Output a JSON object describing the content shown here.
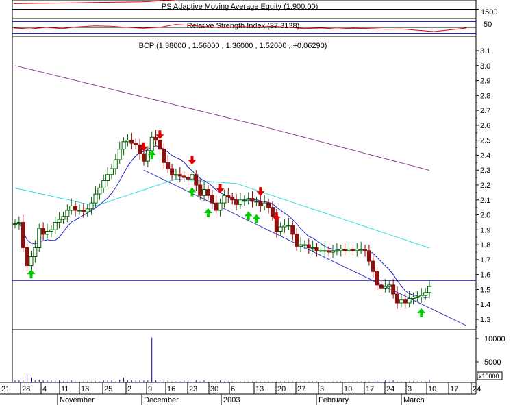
{
  "chart_data": [
    {
      "type": "line",
      "title": "PS Adaptive Moving Average Equity (1,900.00)",
      "y_tick_labels": [
        "1500"
      ],
      "ylim": [
        1400,
        1600
      ],
      "series": [
        {
          "x": [
            0,
            8,
            16,
            24,
            32,
            40,
            48,
            56,
            64,
            72,
            80,
            88,
            96,
            104,
            112
          ],
          "values": [
            1560,
            1565,
            1570,
            1575,
            1580,
            1600,
            1620,
            1640,
            1650,
            1640,
            1660,
            1680,
            1700,
            1700,
            1690
          ]
        }
      ]
    },
    {
      "type": "line",
      "title": "Relative Strength Index (37.3138)",
      "y_tick_labels": [
        "50"
      ],
      "ylim": [
        20,
        80
      ],
      "series": [
        {
          "x": [
            0,
            4,
            8,
            12,
            16,
            20,
            24,
            28,
            32,
            36,
            40,
            44,
            48,
            52,
            56,
            60,
            64,
            68,
            72,
            76,
            80,
            84,
            88,
            92,
            96,
            100,
            104,
            108,
            112
          ],
          "values": [
            48,
            45,
            50,
            46,
            52,
            55,
            54,
            50,
            47,
            50,
            60,
            57,
            52,
            49,
            53,
            51,
            54,
            50,
            46,
            48,
            45,
            47,
            46,
            44,
            45,
            40,
            36,
            42,
            48
          ]
        }
      ]
    },
    {
      "type": "candlestick",
      "title": "BCP (1.38000 , 1.56000 , 1.36000 , 1.52000 , +0.06290)",
      "y_tick_labels": [
        "3.1",
        "3.0",
        "2.9",
        "2.8",
        "2.7",
        "2.6",
        "2.5",
        "2.4",
        "2.3",
        "2.2",
        "2.1",
        "2.0",
        "1.9",
        "1.8",
        "1.7",
        "1.6",
        "1.5",
        "1.4",
        "1.3"
      ],
      "ylim": [
        1.2,
        3.15
      ],
      "x_tick_labels": [
        "21",
        "28",
        "4",
        "11",
        "18",
        "25",
        "2",
        "9",
        "16",
        "23",
        "30",
        "6",
        "13",
        "20",
        "27",
        "3",
        "10",
        "17",
        "24",
        "3",
        "10",
        "17",
        "24"
      ],
      "month_labels": [
        "November",
        "December",
        "2003",
        "February",
        "March"
      ],
      "candles_close": [
        1.94,
        1.95,
        1.78,
        1.66,
        1.72,
        1.78,
        1.91,
        1.87,
        1.89,
        1.9,
        1.95,
        1.97,
        1.99,
        2.03,
        2.06,
        2.03,
        2.03,
        2.02,
        2.04,
        2.08,
        2.14,
        2.18,
        2.23,
        2.27,
        2.31,
        2.37,
        2.44,
        2.49,
        2.5,
        2.48,
        2.47,
        2.41,
        2.36,
        2.43,
        2.52,
        2.5,
        2.44,
        2.35,
        2.31,
        2.27,
        2.27,
        2.26,
        2.25,
        2.24,
        2.27,
        2.2,
        2.13,
        2.17,
        2.13,
        2.08,
        2.03,
        2.08,
        2.13,
        2.12,
        2.1,
        2.07,
        2.1,
        2.1,
        2.11,
        2.09,
        2.09,
        2.06,
        2.08,
        2.05,
        1.99,
        1.89,
        1.92,
        1.93,
        1.93,
        1.87,
        1.79,
        1.8,
        1.8,
        1.78,
        1.78,
        1.76,
        1.76,
        1.76,
        1.75,
        1.76,
        1.76,
        1.77,
        1.76,
        1.77,
        1.76,
        1.77,
        1.77,
        1.76,
        1.69,
        1.62,
        1.53,
        1.51,
        1.52,
        1.53,
        1.47,
        1.41,
        1.43,
        1.41,
        1.44,
        1.45,
        1.45,
        1.46,
        1.48,
        1.52
      ],
      "trend_channel_resistance": 1.56,
      "volume_y_tick_labels": [
        "10000",
        "5000"
      ],
      "volume_unit_label": "x10000",
      "volume": [
        0.2,
        0.2,
        0.2,
        0.9,
        0.5,
        0.2,
        0.3,
        0.2,
        0.2,
        0.2,
        0.2,
        0.2,
        0.1,
        0.1,
        0.2,
        0.1,
        0.1,
        0.1,
        0.1,
        0.1,
        0.1,
        0.1,
        0.2,
        0.2,
        0.2,
        0.1,
        0.3,
        0.5,
        0.2,
        0.2,
        0.2,
        0.2,
        0.2,
        0.2,
        4.8,
        0.2,
        0.3,
        0.2,
        0.2,
        0.1,
        0.1,
        0.1,
        0.2,
        0.2,
        0.3,
        0.2,
        0.1,
        0.2,
        0.1,
        0.1,
        0.1,
        0.2,
        0.1,
        0.1,
        0.1,
        0.1,
        0.1,
        0.1,
        0.1,
        0.1,
        0.1,
        0.1,
        0.1,
        0.1,
        0.1,
        0.1,
        0.1,
        0.1,
        0.1,
        0.1,
        0.1,
        0.1,
        0.1,
        0.1,
        0.1,
        0.1,
        0.1,
        0.1,
        0.1,
        0.1,
        0.1,
        0.1,
        0.1,
        0.1,
        0.1,
        0.1,
        0.1,
        0.1,
        0.1,
        0.1,
        0.2,
        0.1,
        0.2,
        0.1,
        0.2,
        0.1,
        0.1,
        0.1,
        0.1,
        0.1,
        0.1,
        0.1,
        0.1,
        0.3
      ],
      "sell_arrows": [
        32,
        36,
        44,
        51,
        61,
        65
      ],
      "buy_arrows": [
        4,
        34,
        44,
        48,
        58,
        60,
        101
      ]
    }
  ]
}
